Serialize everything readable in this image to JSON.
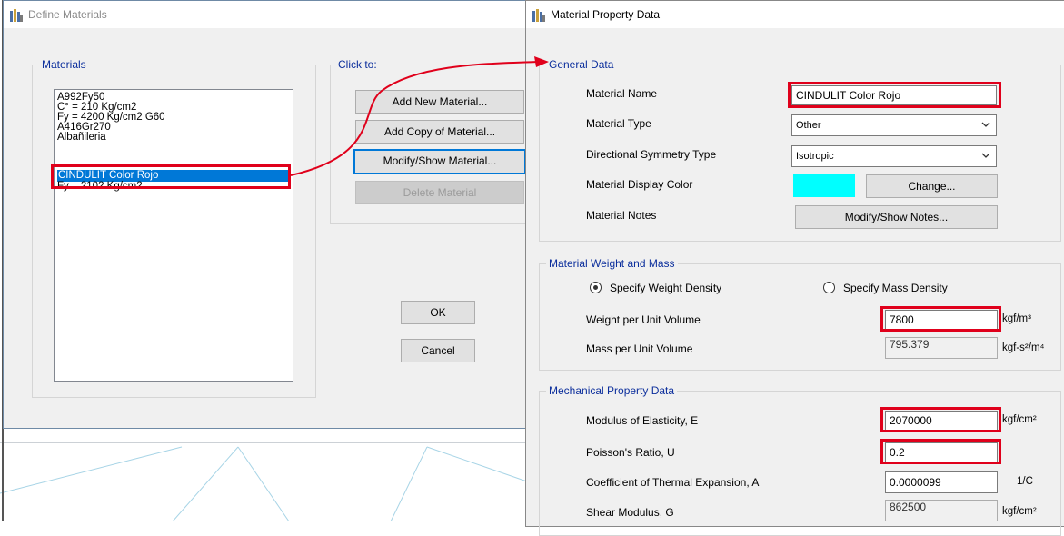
{
  "define_materials": {
    "title": "Define Materials",
    "materials_group": "Materials",
    "click_group": "Click to:",
    "materials": [
      "A992Fy50",
      "C° = 210 Kg/cm2",
      "Fy = 4200 Kg/cm2 G60",
      "A416Gr270",
      "Albañileria",
      "CINDULIT Color Rojo",
      "Fy = 2102 Kg/cm2"
    ],
    "selected_material": "CINDULIT Color Rojo",
    "buttons": {
      "add_new": "Add New Material...",
      "add_copy": "Add Copy of Material...",
      "modify_show": "Modify/Show Material...",
      "delete": "Delete Material",
      "ok": "OK",
      "cancel": "Cancel"
    }
  },
  "material_property": {
    "title": "Material Property Data",
    "general": {
      "group": "General Data",
      "name_label": "Material Name",
      "name_value": "CINDULIT Color Rojo",
      "type_label": "Material Type",
      "type_value": "Other",
      "symmetry_label": "Directional Symmetry Type",
      "symmetry_value": "Isotropic",
      "color_label": "Material Display Color",
      "color_swatch": "#00ffff",
      "change_button": "Change...",
      "notes_label": "Material Notes",
      "notes_button": "Modify/Show Notes..."
    },
    "weight_mass": {
      "group": "Material Weight and Mass",
      "option_weight": "Specify Weight Density",
      "option_mass": "Specify Mass Density",
      "selected_option": "Specify Weight Density",
      "weight_label": "Weight per Unit Volume",
      "weight_value": "7800",
      "weight_unit": "kgf/m³",
      "mass_label": "Mass per Unit Volume",
      "mass_value": "795.379",
      "mass_unit": "kgf-s²/m⁴"
    },
    "mechanical": {
      "group": "Mechanical Property Data",
      "e_label": "Modulus of Elasticity,  E",
      "e_value": "2070000",
      "e_unit": "kgf/cm²",
      "u_label": "Poisson's Ratio,  U",
      "u_value": "0.2",
      "a_label": "Coefficient of Thermal Expansion,  A",
      "a_value": "0.0000099",
      "a_unit": "1/C",
      "g_label": "Shear Modulus,  G",
      "g_value": "862500",
      "g_unit": "kgf/cm²"
    }
  },
  "colors": {
    "highlight": "#e0001b",
    "selection": "#0078d7",
    "group_label": "#0b2e9c"
  },
  "icons": [
    "app-icon",
    "chevron-down-icon",
    "radio-selected-icon",
    "radio-unselected-icon",
    "annotation-arrow"
  ]
}
